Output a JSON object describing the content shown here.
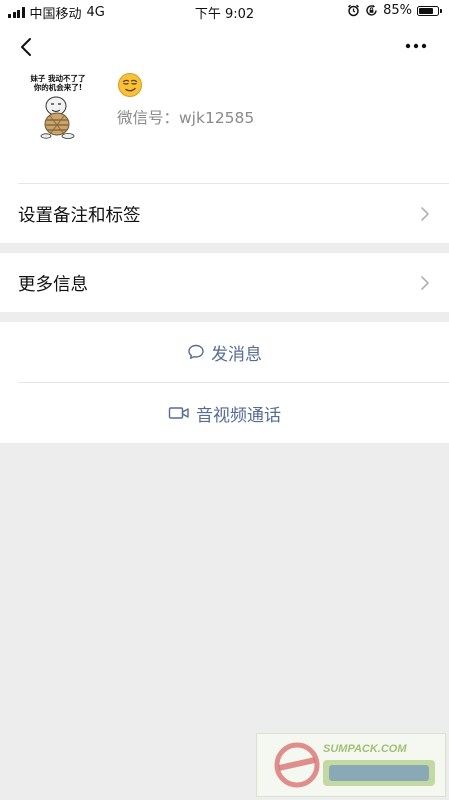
{
  "status_bar": {
    "carrier": "中国移动",
    "network": "4G",
    "time": "下午 9:02",
    "battery_percent_label": "85%",
    "battery_level": 0.85
  },
  "profile": {
    "avatar_caption_line1": "妹子 我动不了了",
    "avatar_caption_line2": "你的机会来了!",
    "nickname_emoji": "smirking-face-emoji",
    "wechat_id_label": "微信号：wjk12585"
  },
  "menu": {
    "remark_tags_label": "设置备注和标签",
    "more_info_label": "更多信息"
  },
  "actions": {
    "send_message_label": "发消息",
    "av_call_label": "音视频通话"
  },
  "icons": {
    "back": "back-arrow-icon",
    "more": "more-dots-icon",
    "chevron": "chevron-right-icon",
    "message": "chat-bubble-icon",
    "video": "video-camera-icon",
    "alarm": "alarm-clock-icon",
    "rotation_lock": "rotation-lock-icon"
  },
  "colors": {
    "page_background": "#ededed",
    "card_background": "#ffffff",
    "link_blue": "#576b95",
    "secondary_text": "#8a8a8a",
    "chevron_gray": "#b2b2b2"
  },
  "watermark": {
    "url_text": "SUMPACK.COM"
  }
}
